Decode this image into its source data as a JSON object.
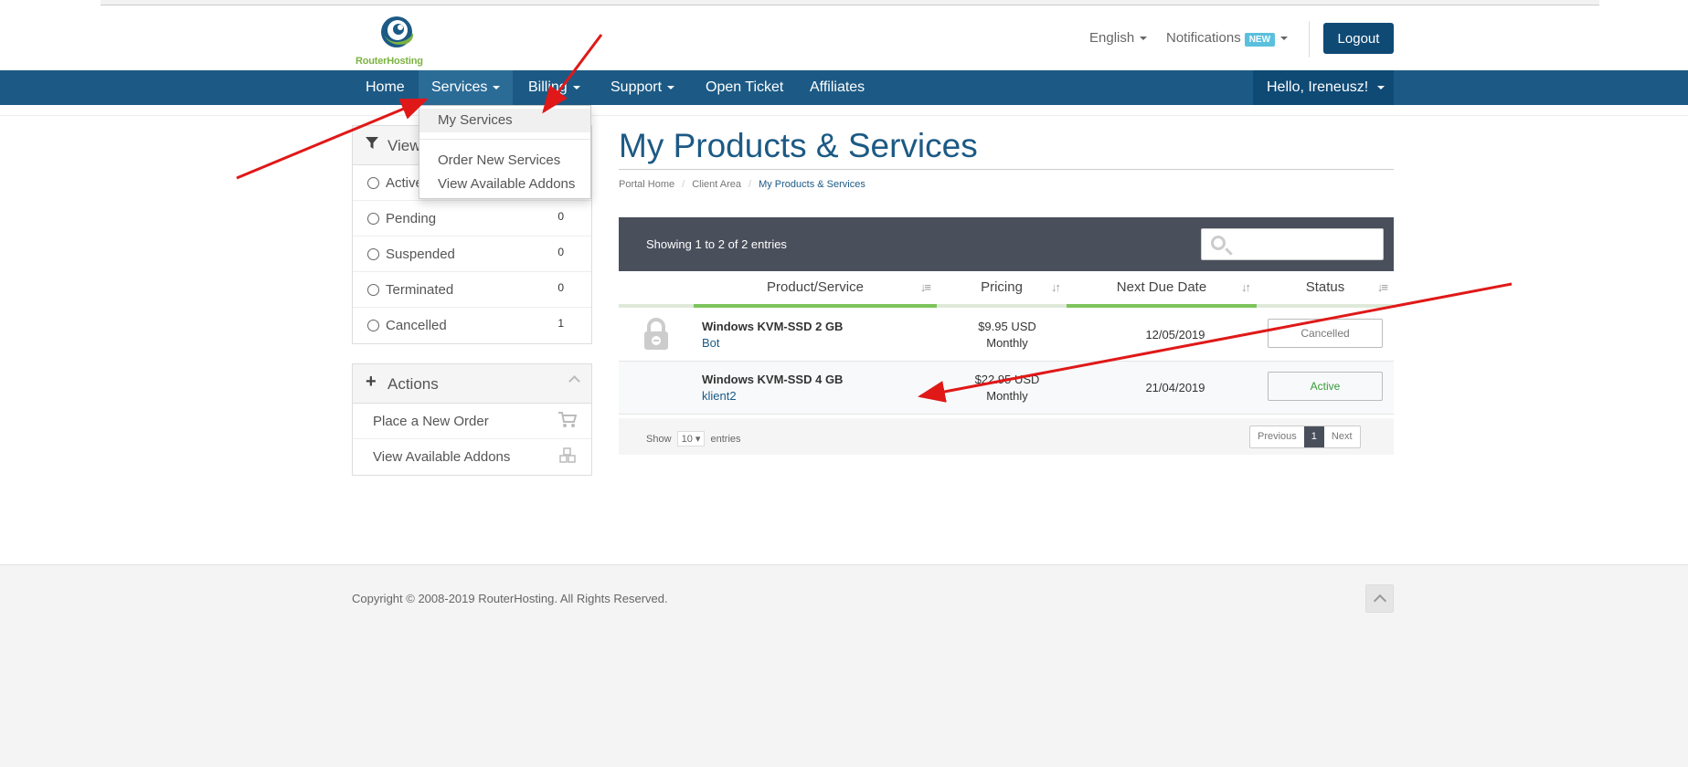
{
  "brand": {
    "logo_text": "RouterHosting"
  },
  "header": {
    "language": "English",
    "notifications": "Notifications",
    "notifications_badge": "NEW",
    "logout": "Logout"
  },
  "nav": {
    "items": [
      {
        "label": "Home"
      },
      {
        "label": "Services"
      },
      {
        "label": "Billing"
      },
      {
        "label": "Support"
      },
      {
        "label": "Open Ticket"
      },
      {
        "label": "Affiliates"
      }
    ],
    "user": "Hello, Ireneusz!"
  },
  "services_menu": {
    "items": [
      {
        "label": "My Services"
      },
      {
        "label": "Order New Services"
      },
      {
        "label": "View Available Addons"
      }
    ]
  },
  "sidebar": {
    "view_title": "View",
    "filters": [
      {
        "label": "Active",
        "count": ""
      },
      {
        "label": "Pending",
        "count": "0"
      },
      {
        "label": "Suspended",
        "count": "0"
      },
      {
        "label": "Terminated",
        "count": "0"
      },
      {
        "label": "Cancelled",
        "count": "1"
      }
    ],
    "actions_title": "Actions",
    "actions": [
      {
        "label": "Place a New Order",
        "icon": "cart-icon"
      },
      {
        "label": "View Available Addons",
        "icon": "cubes-icon"
      }
    ]
  },
  "page": {
    "title": "My Products & Services",
    "breadcrumb": [
      "Portal Home",
      "Client Area",
      "My Products & Services"
    ]
  },
  "table": {
    "info": "Showing 1 to 2 of 2 entries",
    "columns": [
      "Product/Service",
      "Pricing",
      "Next Due Date",
      "Status"
    ],
    "rows": [
      {
        "product": "Windows KVM-SSD 2 GB",
        "label": "Bot",
        "price": "$9.95 USD",
        "cycle": "Monthly",
        "due": "12/05/2019",
        "status": "Cancelled",
        "status_color": "#777777",
        "locked": true
      },
      {
        "product": "Windows KVM-SSD 4 GB",
        "label": "klient2",
        "price": "$22.95 USD",
        "cycle": "Monthly",
        "due": "21/04/2019",
        "status": "Active",
        "status_color": "#3a9a3a",
        "locked": false
      }
    ],
    "length": {
      "show": "Show",
      "value": "10",
      "suffix": "entries"
    },
    "pager": {
      "prev": "Previous",
      "page": "1",
      "next": "Next"
    }
  },
  "footer": {
    "copyright": "Copyright © 2008-2019 RouterHosting. All Rights Reserved."
  },
  "colors": {
    "brand": "#1c5a85",
    "nav": "#1c5a85",
    "accent_green": "#7cc45a",
    "annotation": "#e01818"
  }
}
